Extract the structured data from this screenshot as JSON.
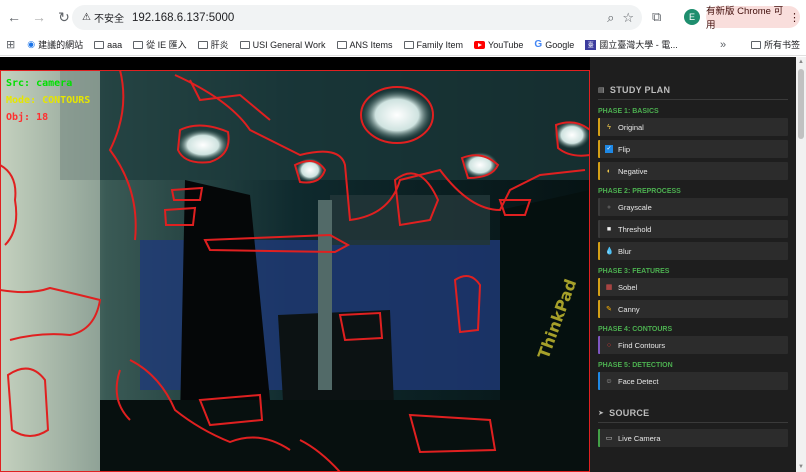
{
  "browser": {
    "insecure_label": "不安全",
    "url": "192.168.6.137:5000",
    "avatar_letter": "E",
    "update_label": "有新版 Chrome 可用"
  },
  "bookmarks": {
    "items": [
      {
        "label": "建議的網站",
        "icon": "chrome-suggested-icon"
      },
      {
        "label": "aaa",
        "icon": "folder-icon"
      },
      {
        "label": "從 IE 匯入",
        "icon": "folder-icon"
      },
      {
        "label": "肝炎",
        "icon": "folder-icon"
      },
      {
        "label": "USI General Work",
        "icon": "folder-icon"
      },
      {
        "label": "ANS Items",
        "icon": "folder-icon"
      },
      {
        "label": "Family Item",
        "icon": "folder-icon"
      },
      {
        "label": "YouTube",
        "icon": "youtube-icon"
      },
      {
        "label": "Google",
        "icon": "google-icon"
      },
      {
        "label": "國立臺灣大學 - 電...",
        "icon": "ntu-icon"
      }
    ],
    "overflow": "»",
    "all_bookmarks": "所有书签"
  },
  "overlay": {
    "src": "Src: camera",
    "mode": "Mode: CONTOURS",
    "obj": "Obj: 18",
    "colors": {
      "src": "#00e000",
      "mode": "#e6e600",
      "obj": "#ff3030"
    }
  },
  "sidebar": {
    "title": "STUDY PLAN",
    "phases": [
      {
        "label": "PHASE 1: BASICS",
        "items": [
          {
            "label": "Original",
            "icon": "bolt-icon"
          },
          {
            "label": "Flip",
            "icon": "checkbox-icon"
          },
          {
            "label": "Negative",
            "icon": "half-moon-icon"
          }
        ]
      },
      {
        "label": "PHASE 2: PREPROCESS",
        "items": [
          {
            "label": "Grayscale",
            "icon": "circle-icon"
          },
          {
            "label": "Threshold",
            "icon": "square-icon"
          },
          {
            "label": "Blur",
            "icon": "droplet-icon"
          }
        ]
      },
      {
        "label": "PHASE 3: FEATURES",
        "items": [
          {
            "label": "Sobel",
            "icon": "chart-icon"
          },
          {
            "label": "Canny",
            "icon": "pencil-icon"
          }
        ]
      },
      {
        "label": "PHASE 4: CONTOURS",
        "items": [
          {
            "label": "Find Contours",
            "icon": "ring-icon"
          }
        ]
      },
      {
        "label": "PHASE 5: DETECTION",
        "items": [
          {
            "label": "Face Detect",
            "icon": "person-icon"
          }
        ]
      }
    ],
    "source_title": "SOURCE",
    "source_items": [
      {
        "label": "Live Camera",
        "icon": "camera-icon"
      }
    ],
    "colors": {
      "phase": "#4caf50",
      "panel": "#1e1e1e",
      "item": "#2c2c2c"
    }
  }
}
